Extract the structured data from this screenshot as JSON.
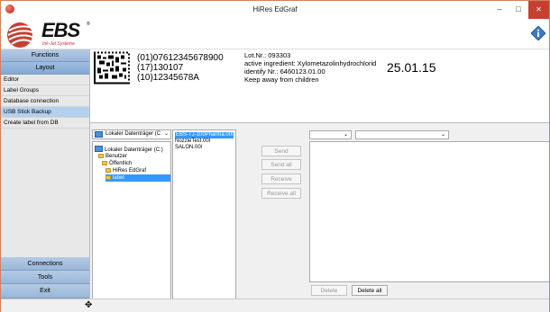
{
  "window": {
    "title": "HiRes EdGraf",
    "min_glyph": "–",
    "max_glyph": "□",
    "close_glyph": "✕"
  },
  "brand": {
    "logo_text": "EBS",
    "logo_reg": "®",
    "logo_sub": "Ink-Jet Systeme",
    "accent": "#c7402f"
  },
  "nav": {
    "functions": "Functions",
    "layout": "Layout",
    "items": [
      "Editor",
      "Label Groups",
      "Database connection",
      "USB Stick Backup",
      "Create label from DB"
    ],
    "selected": "USB Stick Backup",
    "connections": "Connections",
    "tools": "Tools",
    "exit": "Exit"
  },
  "preview": {
    "barcode_lines": [
      "(01)07612345678900",
      "(17)130107",
      "(10)12345678A"
    ],
    "info_lines": [
      "Lot.Nr.: 093303",
      "active ingredient: Xylometazolinhydrochlorid",
      "identify Nr.: 6460123.01.00",
      "Keep away from children"
    ],
    "date": "25.01.15"
  },
  "drive": {
    "selected": "Lokaler Datenträger (C",
    "tree": [
      {
        "label": "Lokaler Datenträger (C:)",
        "type": "drive"
      },
      {
        "label": "Benutzer",
        "type": "folder"
      },
      {
        "label": "Öffentlich",
        "type": "folder"
      },
      {
        "label": "HiRes EdGraf",
        "type": "folder"
      },
      {
        "label": "label",
        "type": "folder",
        "selected": true
      }
    ]
  },
  "files": [
    "EBS-TJ-100Pharma.00l",
    "NozzleTest.00l",
    "SALON.00l"
  ],
  "transfer": {
    "send": "Send",
    "send_all": "Send all",
    "receive": "Receive",
    "receive_all": "Receive all"
  },
  "right": {
    "select1": "",
    "select2": "",
    "delete": "Delete",
    "delete_all": "Delete all"
  }
}
